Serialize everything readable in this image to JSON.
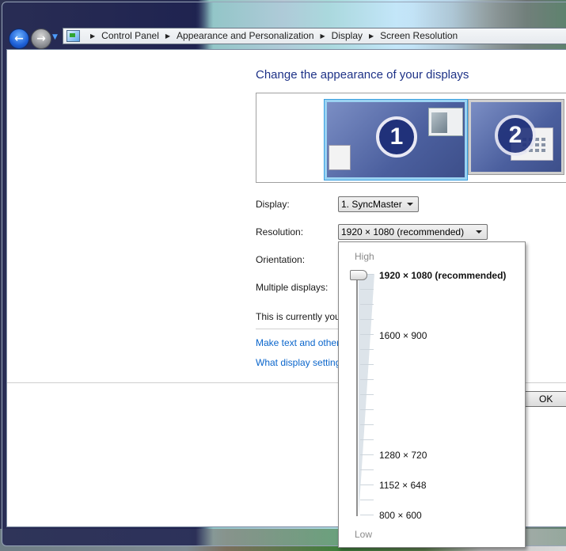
{
  "window": {
    "breadcrumb": [
      "Control Panel",
      "Appearance and Personalization",
      "Display",
      "Screen Resolution"
    ],
    "nav": {
      "back_icon": "back-arrow-icon",
      "forward_icon": "forward-arrow-icon",
      "history_icon": "chevron-down-icon",
      "back_glyph": "←",
      "forward_glyph": "→",
      "history_glyph": "▼"
    }
  },
  "page": {
    "title": "Change the appearance of your displays",
    "monitors": [
      {
        "number": "1",
        "selected": true
      },
      {
        "number": "2",
        "selected": false
      }
    ],
    "fields": {
      "display_label": "Display:",
      "display_value": "1. SyncMaster",
      "resolution_label": "Resolution:",
      "resolution_value": "1920 × 1080 (recommended)",
      "orientation_label": "Orientation:",
      "multiple_label": "Multiple displays:"
    },
    "status_text": "This is currently you",
    "links": [
      "Make text and other",
      "What display setting"
    ],
    "ok_label": "OK"
  },
  "resolution_popup": {
    "high_label": "High",
    "low_label": "Low",
    "options": [
      {
        "label": "1920 × 1080 (recommended)",
        "selected": true
      },
      {
        "label": "1600 × 900",
        "selected": false
      },
      {
        "label": "1280 × 720",
        "selected": false
      },
      {
        "label": "1152 × 648",
        "selected": false
      },
      {
        "label": "800 × 600",
        "selected": false
      }
    ],
    "slider_position": "top (highest resolution)"
  }
}
